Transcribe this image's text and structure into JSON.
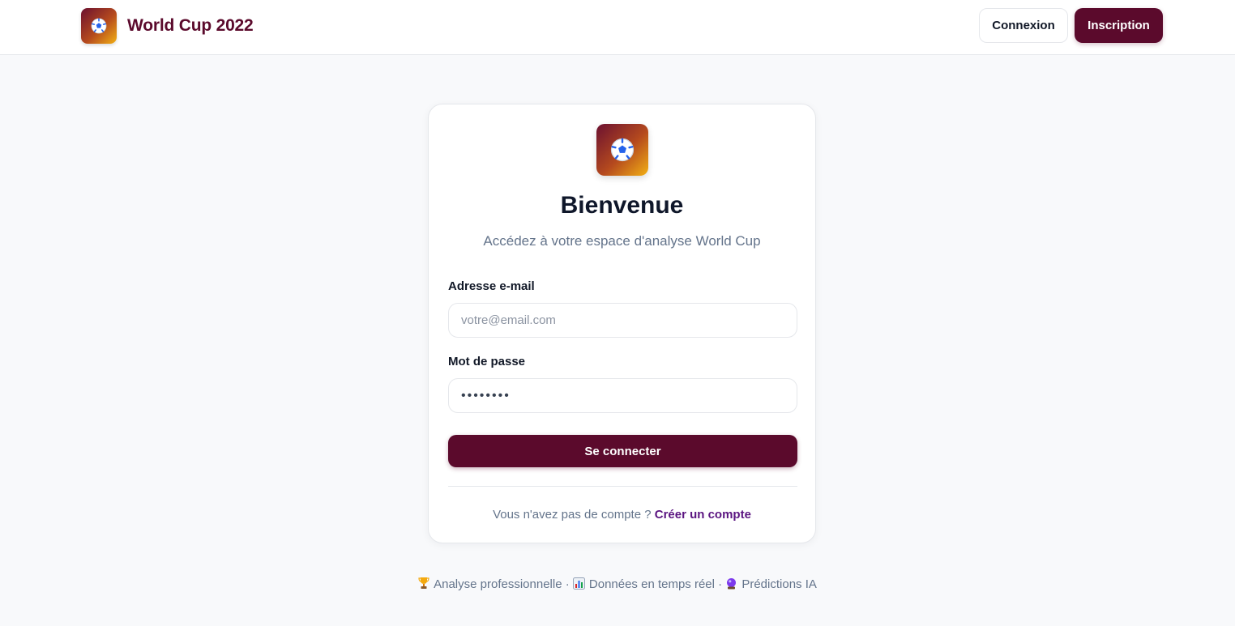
{
  "header": {
    "brand_title": "World Cup 2022",
    "logo_icon": "soccer-ball-icon",
    "login_label": "Connexion",
    "signup_label": "Inscription"
  },
  "card": {
    "title": "Bienvenue",
    "subtitle": "Accédez à votre espace d'analyse World Cup",
    "email_label": "Adresse e-mail",
    "email_placeholder": "votre@email.com",
    "email_value": "",
    "password_label": "Mot de passe",
    "password_value": "••••••••",
    "submit_label": "Se connecter",
    "no_account_text": "Vous n'avez pas de compte ?",
    "create_account_label": "Créer un compte"
  },
  "footer": {
    "items": [
      {
        "icon": "trophy-icon",
        "label": "Analyse professionnelle"
      },
      {
        "icon": "bar-chart-icon",
        "label": "Données en temps réel"
      },
      {
        "icon": "crystal-ball-icon",
        "label": "Prédictions IA"
      }
    ],
    "separator": "·"
  },
  "colors": {
    "brand": "#5b0a2c",
    "link": "#5a1480",
    "background": "#f8f9fb",
    "muted_text": "#64748b"
  }
}
